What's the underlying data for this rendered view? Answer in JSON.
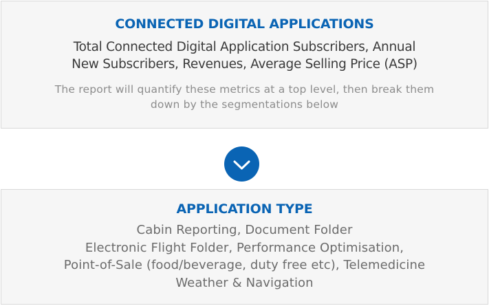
{
  "top_box": {
    "heading": "CONNECTED DIGITAL APPLICATIONS",
    "subtitle_lines": [
      "Total Connected Digital Application Subscribers, Annual",
      "New Subscribers, Revenues, Average Selling Price (ASP)"
    ],
    "note_lines": [
      "The report will quantify these metrics at a top level, then break them",
      "down by the segmentations below"
    ]
  },
  "connector": {
    "icon": "chevron-down-icon",
    "color": "#0a64b4"
  },
  "bottom_box": {
    "heading": "APPLICATION TYPE",
    "item_lines": [
      "Cabin Reporting, Document Folder",
      "Electronic Flight Folder, Performance Optimisation,",
      "Point-of-Sale (food/beverage, duty free etc), Telemedicine",
      "Weather & Navigation"
    ]
  },
  "colors": {
    "heading": "#0a64b4",
    "box_background": "#f6f6f6",
    "box_border": "#d9d9d9"
  }
}
